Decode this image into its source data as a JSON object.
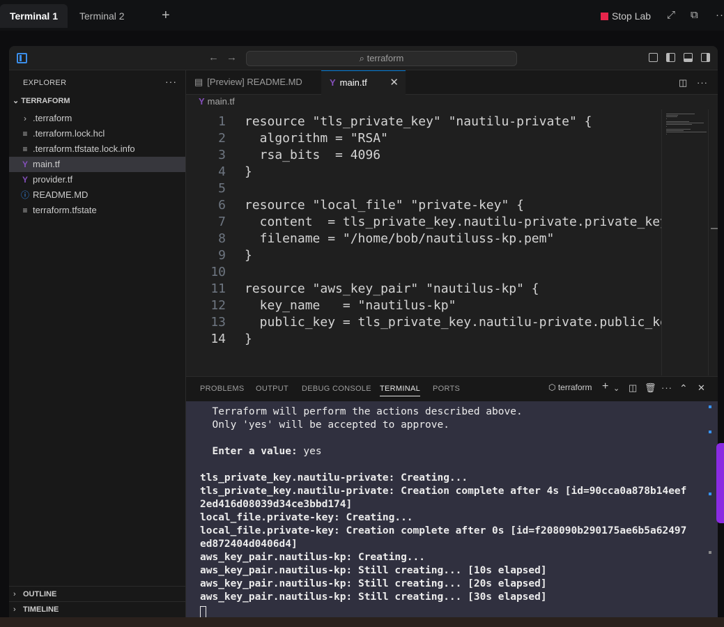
{
  "lab": {
    "tabs": [
      "Terminal 1",
      "Terminal 2"
    ],
    "add_tab": "+",
    "stop_label": "Stop Lab",
    "icons": [
      "fullscreen-icon",
      "open-external-icon",
      "more-icon"
    ]
  },
  "window": {
    "search_text": "terraform",
    "accent": "#0078d4"
  },
  "explorer": {
    "header": "EXPLORER",
    "more": "···",
    "root": "TERRAFORM",
    "items": [
      {
        "label": ".terraform",
        "icon": "chevron-right-icon",
        "glyph": "›"
      },
      {
        "label": ".terraform.lock.hcl",
        "icon": "lines-icon",
        "glyph": "≡"
      },
      {
        "label": ".terraform.tfstate.lock.info",
        "icon": "lines-icon",
        "glyph": "≡"
      },
      {
        "label": "main.tf",
        "icon": "terraform-icon",
        "glyph": "Y",
        "selected": true
      },
      {
        "label": "provider.tf",
        "icon": "terraform-icon",
        "glyph": "Y"
      },
      {
        "label": "README.MD",
        "icon": "info-icon",
        "glyph": "ⓘ"
      },
      {
        "label": "terraform.tfstate",
        "icon": "lines-icon",
        "glyph": "≡"
      }
    ],
    "outline": "OUTLINE",
    "timeline": "TIMELINE"
  },
  "editor": {
    "tabs": [
      {
        "label": "[Preview] README.MD",
        "active": false
      },
      {
        "label": "main.tf",
        "active": true
      }
    ],
    "breadcrumb": "main.tf",
    "current_line": 14,
    "lines": [
      {
        "n": "1",
        "text": "resource \"tls_private_key\" \"nautilu-private\" {"
      },
      {
        "n": "2",
        "text": "  algorithm = \"RSA\""
      },
      {
        "n": "3",
        "text": "  rsa_bits  = 4096"
      },
      {
        "n": "4",
        "text": "}"
      },
      {
        "n": "5",
        "text": ""
      },
      {
        "n": "6",
        "text": "resource \"local_file\" \"private-key\" {"
      },
      {
        "n": "7",
        "text": "  content  = tls_private_key.nautilu-private.private_key_pem"
      },
      {
        "n": "8",
        "text": "  filename = \"/home/bob/nautiluss-kp.pem\""
      },
      {
        "n": "9",
        "text": "}"
      },
      {
        "n": "10",
        "text": ""
      },
      {
        "n": "11",
        "text": "resource \"aws_key_pair\" \"nautilus-kp\" {"
      },
      {
        "n": "12",
        "text": "  key_name   = \"nautilus-kp\""
      },
      {
        "n": "13",
        "text": "  public_key = tls_private_key.nautilu-private.public_key_openssh"
      },
      {
        "n": "14",
        "text": "}"
      }
    ]
  },
  "panel": {
    "tabs": [
      "PROBLEMS",
      "OUTPUT",
      "DEBUG CONSOLE",
      "TERMINAL",
      "PORTS"
    ],
    "active_tab": "TERMINAL",
    "terminal_name": "terraform",
    "terminal_lines": [
      {
        "text": "  Terraform will perform the actions described above.",
        "bold": false
      },
      {
        "text": "  Only 'yes' will be accepted to approve.",
        "bold": false
      },
      {
        "text": "",
        "bold": false
      },
      {
        "text": "  Enter a value: yes",
        "bold": false
      },
      {
        "text": "",
        "bold": false
      },
      {
        "text": "tls_private_key.nautilu-private: Creating...",
        "bold": true
      },
      {
        "text": "tls_private_key.nautilu-private: Creation complete after 4s [id=90cca0a878b14eef",
        "bold": true
      },
      {
        "text": "2ed416d08039d34ce3bbd174]",
        "bold": true
      },
      {
        "text": "local_file.private-key: Creating...",
        "bold": true
      },
      {
        "text": "local_file.private-key: Creation complete after 0s [id=f208090b290175ae6b5a62497",
        "bold": true
      },
      {
        "text": "ed872404d0406d4]",
        "bold": true
      },
      {
        "text": "aws_key_pair.nautilus-kp: Creating...",
        "bold": true
      },
      {
        "text": "aws_key_pair.nautilus-kp: Still creating... [10s elapsed]",
        "bold": true
      },
      {
        "text": "aws_key_pair.nautilus-kp: Still creating... [20s elapsed]",
        "bold": true
      },
      {
        "text": "aws_key_pair.nautilus-kp: Still creating... [30s elapsed]",
        "bold": true
      }
    ]
  }
}
